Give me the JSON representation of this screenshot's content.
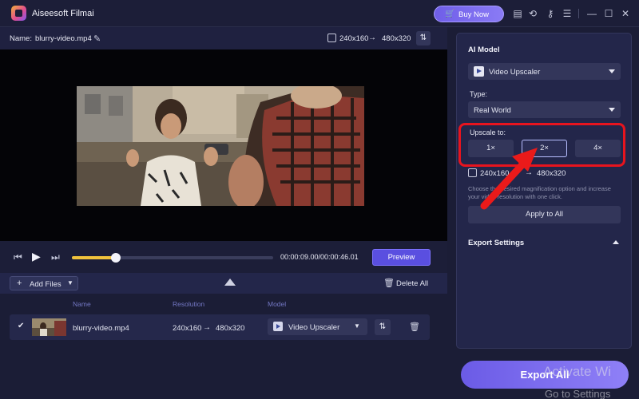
{
  "app": {
    "title": "Aiseesoft Filmai"
  },
  "titlebar": {
    "buy_now": "Buy Now",
    "icons": [
      "cart-icon",
      "feedback-icon",
      "history-icon",
      "key-icon",
      "menu-icon",
      "minimize-icon",
      "maximize-icon",
      "close-icon"
    ]
  },
  "video": {
    "name_label": "Name:",
    "filename": "blurry-video.mp4",
    "res_from": "240x160",
    "res_arrow": "→",
    "res_to": "480x320"
  },
  "player": {
    "timecode": "00:00:09.00/00:00:46.01",
    "progress": 0.22,
    "preview": "Preview"
  },
  "files": {
    "add_files": "Add Files",
    "delete_all": "Delete All",
    "columns": {
      "name": "Name",
      "resolution": "Resolution",
      "model": "Model"
    },
    "rows": [
      {
        "name": "blurry-video.mp4",
        "res_from": "240x160",
        "res_arrow": "→",
        "res_to": "480x320",
        "model": "Video Upscaler"
      }
    ]
  },
  "right_panel": {
    "ai_model_title": "AI Model",
    "model": "Video Upscaler",
    "type_label": "Type:",
    "type_value": "Real World",
    "upscale_label": "Upscale to:",
    "scales": [
      "1×",
      "2×",
      "4×"
    ],
    "selected_scale": "2×",
    "out_from": "240x160",
    "out_arrow": "→",
    "out_to": "480x320",
    "hint": "Choose the desired magnification option and increase your video resolution with one click.",
    "apply_all": "Apply to All",
    "export_settings": "Export Settings"
  },
  "export_all": "Export All",
  "watermark": {
    "line1": "Activate Wi",
    "line2": "Go to Settings"
  },
  "colors": {
    "accent": "#6b5be6",
    "highlight": "#e8141e",
    "progress": "#f0c23c"
  }
}
